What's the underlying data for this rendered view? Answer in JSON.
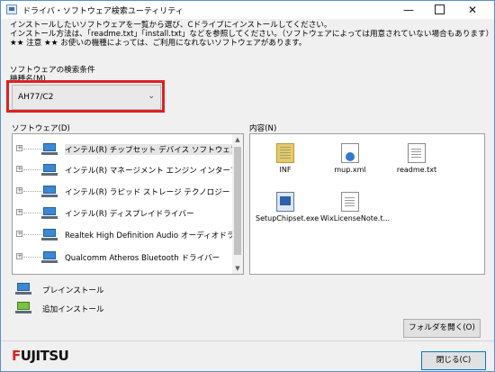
{
  "window": {
    "title": "ドライバ・ソフトウェア検索ユーティリティ",
    "minimize_glyph": "—",
    "close_glyph": "✕"
  },
  "info": {
    "line1": "インストールしたいソフトウェアを一覧から選び、Cドライブにインストールしてください。",
    "line2": "インストール方法は、「readme.txt」「install.txt」などを参照してください。（ソフトウェアによっては用意されていない場合もあります）",
    "line3": "★★ 注意 ★★ お使いの機種によっては、ご利用になれないソフトウェアがあります。"
  },
  "search": {
    "section_label": "ソフトウェアの検索条件",
    "model_label": "機種名(M)",
    "model_value": "AH77/C2"
  },
  "software": {
    "label": "ソフトウェア(D)",
    "items": [
      {
        "label": "インテル(R) チップセット デバイス ソフトウェア",
        "icon": "laptop-blue-icon"
      },
      {
        "label": "インテル(R) マネージメント エンジン インターフェ",
        "icon": "laptop-blue-icon"
      },
      {
        "label": "インテル(R) ラピッド ストレージ テクノロジー",
        "icon": "laptop-blue-icon"
      },
      {
        "label": "インテル(R) ディスプレイドライバー",
        "icon": "laptop-blue-icon"
      },
      {
        "label": "Realtek High Definition Audio オーディオドライバ",
        "icon": "laptop-blue-icon"
      },
      {
        "label": "Qualcomm Atheros Bluetooth ドライバー",
        "icon": "laptop-blue-icon"
      }
    ]
  },
  "contents": {
    "label": "内容(N)",
    "files": [
      {
        "name": "INF",
        "icon": "folder-icon"
      },
      {
        "name": "mup.xml",
        "icon": "xml-file-icon"
      },
      {
        "name": "readme.txt",
        "icon": "text-file-icon"
      },
      {
        "name": "SetupChipset.exe",
        "icon": "exe-file-icon"
      },
      {
        "name": "WixLicenseNote.t...",
        "icon": "text-file-icon"
      }
    ]
  },
  "legend": {
    "preinstall": "プレインストール",
    "additional": "追加インストール"
  },
  "buttons": {
    "open_folder": "フォルダを開く(O)",
    "close": "閉じる(C)"
  },
  "brand": {
    "logo": "FUJITSU",
    "accent": "#e0211f"
  }
}
